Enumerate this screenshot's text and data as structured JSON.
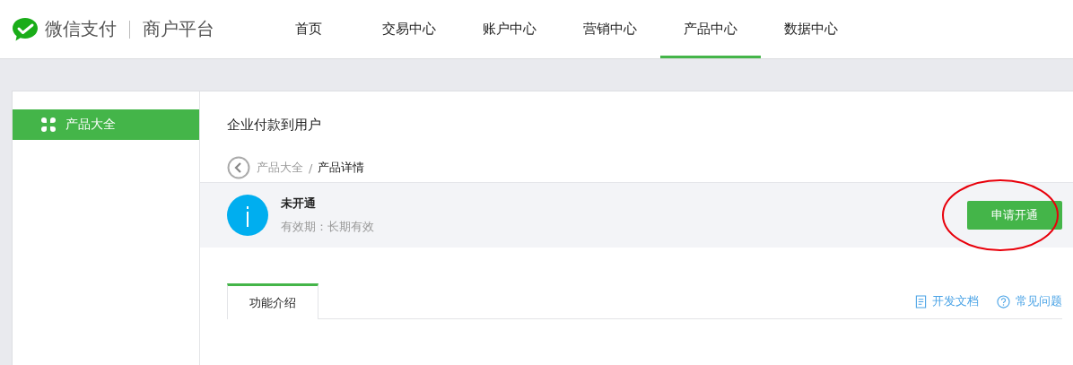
{
  "brand": {
    "name": "微信支付",
    "subtitle": "商户平台"
  },
  "nav": [
    {
      "label": "首页",
      "selected": false
    },
    {
      "label": "交易中心",
      "selected": false
    },
    {
      "label": "账户中心",
      "selected": false
    },
    {
      "label": "营销中心",
      "selected": false
    },
    {
      "label": "产品中心",
      "selected": true
    },
    {
      "label": "数据中心",
      "selected": false
    }
  ],
  "sidebar": {
    "items": [
      {
        "label": "产品大全",
        "selected": true
      }
    ]
  },
  "page_title": "企业付款到用户",
  "breadcrumb": [
    {
      "label": "产品大全",
      "kind": "link"
    },
    {
      "label": "/",
      "kind": "separator"
    },
    {
      "label": "产品详情",
      "kind": "current"
    }
  ],
  "status": {
    "title": "未开通",
    "validity": "有效期：长期有效",
    "button": "申请开通",
    "highlighted": true
  },
  "tabs": [
    {
      "label": "功能介绍",
      "selected": true
    }
  ],
  "links": [
    {
      "label": "开发文档",
      "kind": "doc"
    },
    {
      "label": "常见问题",
      "kind": "faq"
    }
  ]
}
